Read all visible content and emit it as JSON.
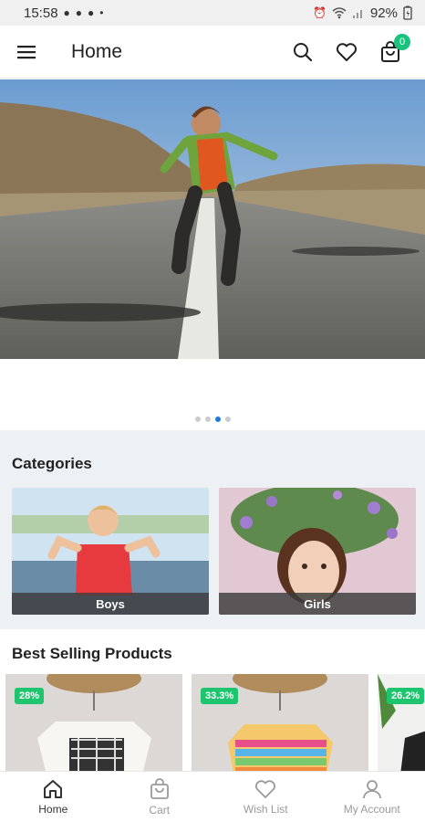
{
  "status_bar": {
    "time": "15:58",
    "battery": "92%"
  },
  "app_bar": {
    "menu_icon": "menu-icon",
    "title": "Home",
    "icons": [
      "search-icon",
      "heart-icon",
      "cart-icon"
    ],
    "cart_badge": "0"
  },
  "carousel": {
    "slide_count": 4,
    "active_index": 2
  },
  "categories": {
    "title": "Categories",
    "items": [
      {
        "label": "Boys"
      },
      {
        "label": "Girls"
      }
    ]
  },
  "best_selling": {
    "title": "Best Selling Products",
    "products": [
      {
        "discount": "28%"
      },
      {
        "discount": "33.3%"
      },
      {
        "discount": "26.2%"
      }
    ]
  },
  "bottom_nav": {
    "items": [
      {
        "label": "Home",
        "icon": "home-icon",
        "active": true
      },
      {
        "label": "Cart",
        "icon": "cart-icon",
        "active": false
      },
      {
        "label": "Wish List",
        "icon": "heart-icon",
        "active": false
      },
      {
        "label": "My Account",
        "icon": "user-icon",
        "active": false
      }
    ]
  },
  "colors": {
    "accent": "#1f7ae0",
    "badge_green": "#19c37d",
    "discount_green": "#1fc56e",
    "section_bg": "#eef1f4"
  }
}
